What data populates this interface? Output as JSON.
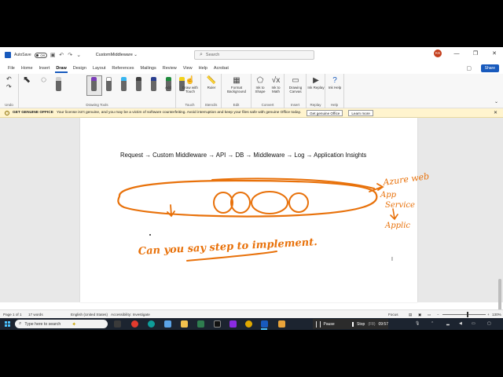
{
  "titlebar": {
    "autosave_label": "AutoSave",
    "autosave_state": "Off",
    "doc_title": "CustomMiddleware ⌄",
    "search_placeholder": "Search",
    "user_initials": "KS"
  },
  "tabs": [
    "File",
    "Home",
    "Insert",
    "Draw",
    "Design",
    "Layout",
    "References",
    "Mailings",
    "Review",
    "View",
    "Help",
    "Acrobat"
  ],
  "active_tab": "Draw",
  "share_label": "Share",
  "ribbon": {
    "groups": [
      {
        "label": "Undo"
      },
      {
        "label": "Drawing Tools"
      },
      {
        "label": "Touch"
      },
      {
        "label": "Stencils"
      },
      {
        "label": "Edit"
      },
      {
        "label": "Convert"
      },
      {
        "label": "Insert"
      },
      {
        "label": "Replay"
      },
      {
        "label": "Help"
      }
    ],
    "buttons": {
      "add": "Add",
      "draw_with_touch": "Draw with Touch",
      "ruler": "Ruler",
      "format_background": "Format Background",
      "ink_to_shape": "Ink to Shape",
      "ink_to_math": "Ink to Math",
      "drawing_canvas": "Drawing Canvas",
      "ink_replay": "Ink Replay",
      "ink_help": "Ink Help"
    },
    "pen_colors": [
      "#d0d0d0",
      "#7a3cb8",
      "#ffffff",
      "#38b6f0",
      "#404040",
      "#222222",
      "#2a3f8f",
      "#1e8a3c",
      "#f2d21b"
    ]
  },
  "warning": {
    "title": "GET GENUINE OFFICE",
    "message": "Your license isn't genuine, and you may be a victim of software counterfeiting. Avoid interruption and keep your files safe with genuine Office today.",
    "button_genuine": "Get genuine Office",
    "button_learn": "Learn more"
  },
  "document": {
    "flow_text": "Request → Custom Middleware → API → DB → Middleware → Log → Application Insights",
    "ink_annotations": [
      "Azure web",
      "App",
      "Service",
      "Applic",
      "Can you say step to implement."
    ]
  },
  "statusbar": {
    "page": "Page 1 of 1",
    "words": "17 words",
    "language": "English (United States)",
    "accessibility": "Accessibility: Investigate",
    "focus": "Focus",
    "zoom": "130%"
  },
  "taskbar": {
    "search_placeholder": "Type here to search",
    "pause_label": "Pause",
    "stop_label": "Stop",
    "stop_shortcut": "(F8)",
    "timer": "09:57"
  },
  "colors": {
    "accent": "#185abd",
    "ink": "#e8710a",
    "warning_bg": "#fff4ce"
  }
}
